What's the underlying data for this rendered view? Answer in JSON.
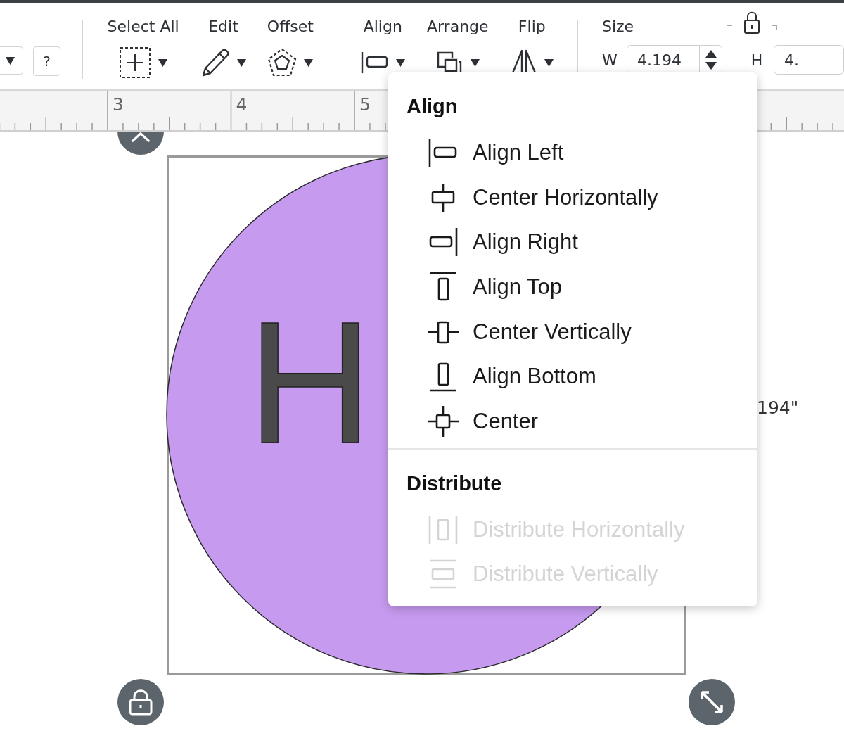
{
  "toolbar": {
    "help_button": "?",
    "edit_tools": [
      {
        "label": "Select All",
        "kind": "select-all"
      },
      {
        "label": "Edit",
        "kind": "edit"
      },
      {
        "label": "Offset",
        "kind": "offset"
      }
    ],
    "layout_tools": [
      {
        "label": "Align",
        "kind": "align"
      },
      {
        "label": "Arrange",
        "kind": "arrange"
      },
      {
        "label": "Flip",
        "kind": "flip"
      }
    ],
    "size": {
      "label": "Size",
      "width_label": "W",
      "width_value": "4.194",
      "height_label": "H",
      "height_value": "4."
    }
  },
  "ruler": {
    "labels": [
      "3",
      "4",
      "5"
    ]
  },
  "canvas": {
    "text": "H",
    "dimension": "194\""
  },
  "align_menu": {
    "sections": [
      {
        "title": "Align",
        "items": [
          {
            "label": "Align Left",
            "kind": "align-left",
            "disabled": false
          },
          {
            "label": "Center Horizontally",
            "kind": "center-horizontal",
            "disabled": false
          },
          {
            "label": "Align Right",
            "kind": "align-right",
            "disabled": false
          },
          {
            "label": "Align Top",
            "kind": "align-top",
            "disabled": false
          },
          {
            "label": "Center Vertically",
            "kind": "center-vertical",
            "disabled": false
          },
          {
            "label": "Align Bottom",
            "kind": "align-bottom",
            "disabled": false
          },
          {
            "label": "Center",
            "kind": "center",
            "disabled": false
          }
        ]
      },
      {
        "title": "Distribute",
        "items": [
          {
            "label": "Distribute Horizontally",
            "kind": "distribute-horizontal",
            "disabled": true
          },
          {
            "label": "Distribute Vertically",
            "kind": "distribute-vertical",
            "disabled": true
          }
        ]
      }
    ]
  }
}
